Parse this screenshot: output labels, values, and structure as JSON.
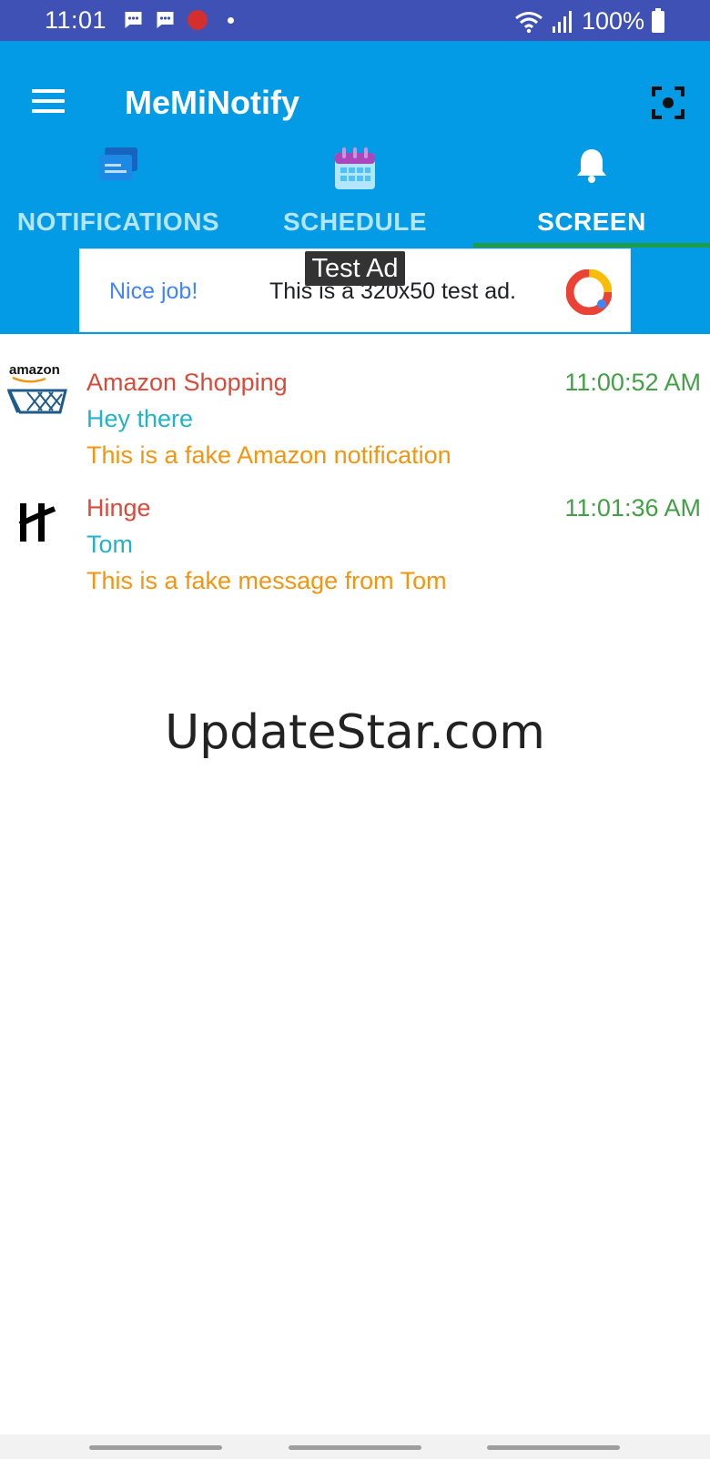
{
  "status_bar": {
    "time": "11:01",
    "battery": "100%",
    "icons": [
      "message-icon",
      "message-icon",
      "recording-dot-icon",
      "dot-icon",
      "wifi-icon",
      "signal-icon",
      "battery-icon"
    ]
  },
  "app_bar": {
    "title": "MeMiNotify",
    "menu_icon": "hamburger-menu-icon",
    "action_icon": "focus-frame-icon",
    "color": "#039be5"
  },
  "tabs": [
    {
      "label": "NOTIFICATIONS",
      "icon": "notifications-tab-icon",
      "active": false
    },
    {
      "label": "SCHEDULE",
      "icon": "calendar-icon",
      "active": false
    },
    {
      "label": "SCREEN",
      "icon": "bell-icon",
      "active": true
    }
  ],
  "ad": {
    "badge": "Test Ad",
    "headline": "Nice job!",
    "text": "This is a 320x50 test ad."
  },
  "notifications": [
    {
      "app": "Amazon Shopping",
      "title": "Hey there",
      "body": "This is a fake Amazon notification",
      "time": "11:00:52 AM",
      "logo_text": "amazon",
      "icon": "amazon-cart-icon"
    },
    {
      "app": "Hinge",
      "title": "Tom",
      "body": "This is a fake message from Tom",
      "time": "11:01:36 AM",
      "icon": "hinge-logo-icon"
    }
  ],
  "watermark": "UpdateStar.com",
  "colors": {
    "status_bar": "#3f51b5",
    "app_name": "#d84a3a",
    "title": "#24b2c7",
    "body": "#f29510",
    "time": "#43a047",
    "tab_indicator": "#1b9e4a"
  }
}
